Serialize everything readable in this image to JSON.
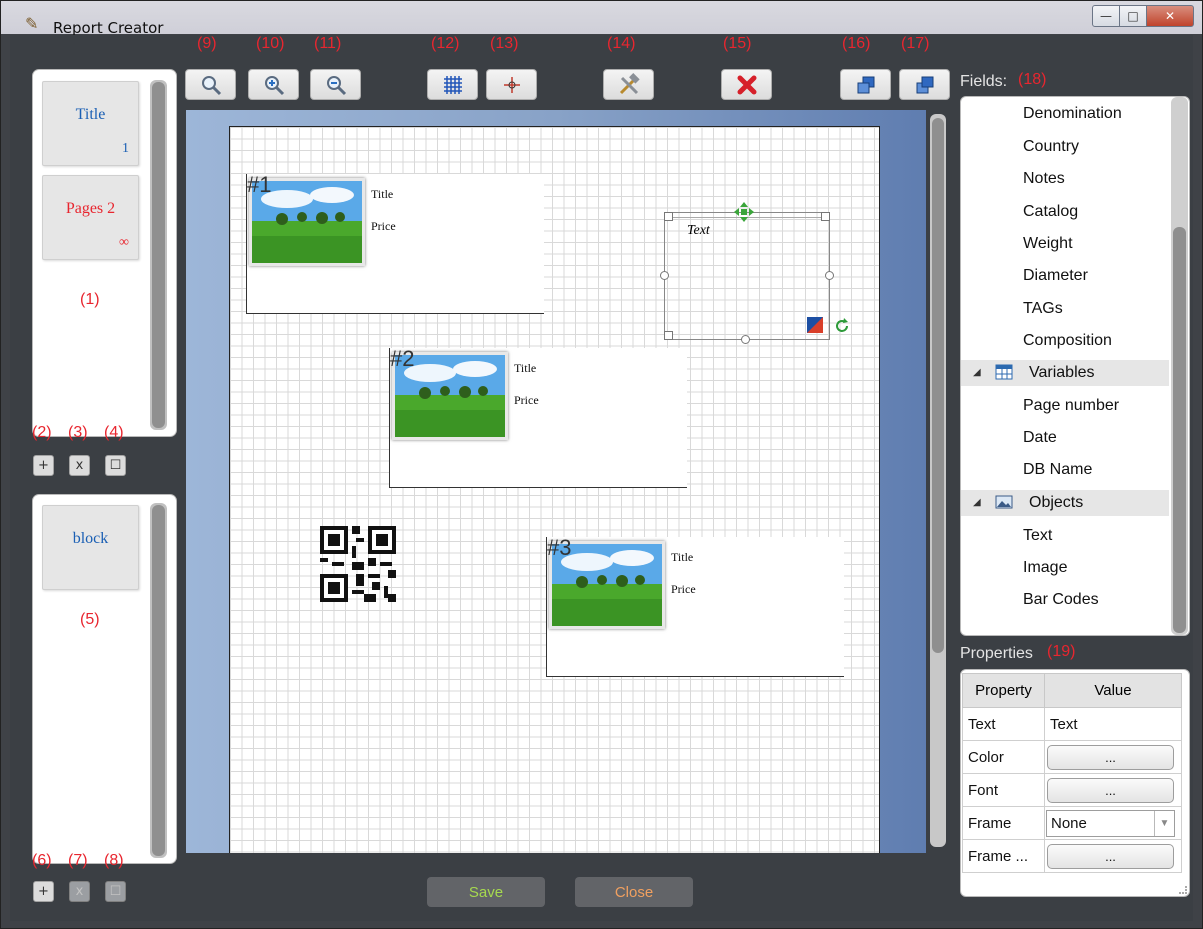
{
  "window": {
    "title": "Report Creator"
  },
  "callouts": {
    "c1": "(1)",
    "c2": "(2)",
    "c3": "(3)",
    "c4": "(4)",
    "c5": "(5)",
    "c6": "(6)",
    "c7": "(7)",
    "c8": "(8)",
    "c9": "(9)",
    "c10": "(10)",
    "c11": "(11)",
    "c12": "(12)",
    "c13": "(13)",
    "c14": "(14)",
    "c15": "(15)",
    "c16": "(16)",
    "c17": "(17)",
    "c18": "(18)",
    "c19": "(19)"
  },
  "pages": [
    {
      "title": "Title",
      "number": "1",
      "color": "#1a5fb4"
    },
    {
      "title": "Pages 2",
      "number": "∞",
      "color": "#e8262f"
    }
  ],
  "blocks_panel": {
    "items": [
      "block"
    ]
  },
  "small_buttons": {
    "add": "+",
    "remove": "x",
    "copy": "☐"
  },
  "canvas": {
    "blocks": [
      {
        "num": "#1",
        "title": "Title",
        "price": "Price"
      },
      {
        "num": "#2",
        "title": "Title",
        "price": "Price"
      },
      {
        "num": "#3",
        "title": "Title",
        "price": "Price"
      }
    ],
    "text_object": "Text"
  },
  "footer": {
    "save": "Save",
    "close": "Close",
    "save_color": "#a6d94f",
    "close_color": "#f0a060"
  },
  "fields": {
    "label": "Fields:",
    "items": [
      "Denomination",
      "Country",
      "Notes",
      "Catalog",
      "Weight",
      "Diameter",
      "TAGs",
      "Composition"
    ],
    "variables_group": "Variables",
    "variables": [
      "Page number",
      "Date",
      "DB Name"
    ],
    "objects_group": "Objects",
    "objects": [
      "Text",
      "Image",
      "Bar Codes"
    ]
  },
  "properties": {
    "label": "Properties",
    "col_property": "Property",
    "col_value": "Value",
    "rows": [
      {
        "name": "Text",
        "value": "Text"
      },
      {
        "name": "Color",
        "value": "..."
      },
      {
        "name": "Font",
        "value": "..."
      },
      {
        "name": "Frame",
        "value": "None"
      },
      {
        "name": "Frame ...",
        "value": "..."
      }
    ]
  }
}
